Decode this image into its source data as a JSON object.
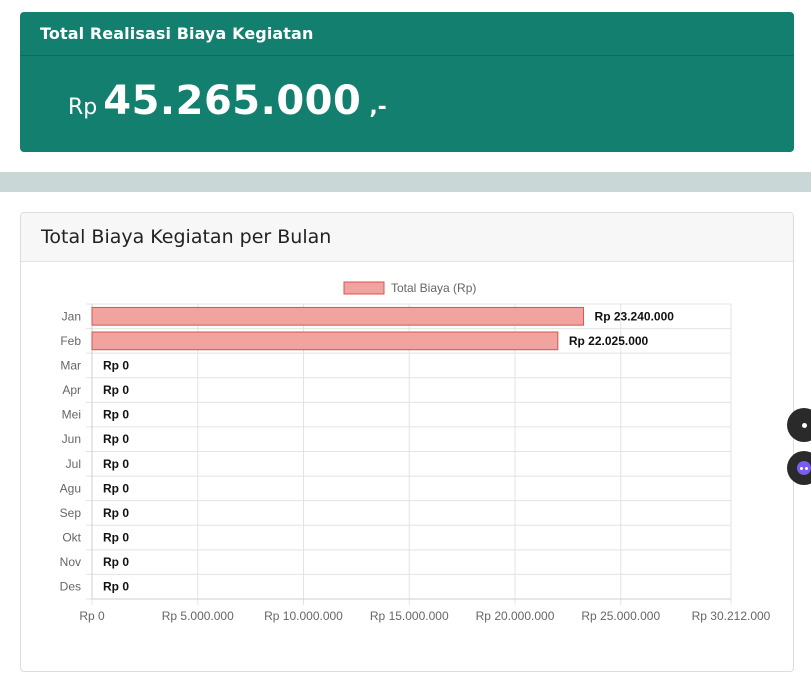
{
  "summary": {
    "title": "Total Realisasi Biaya Kegiatan",
    "currency": "Rp",
    "amount": "45.265.000",
    "suffix": ",-"
  },
  "chart_card": {
    "title": "Total Biaya Kegiatan per Bulan"
  },
  "colors": {
    "summary_bg": "#137f6e",
    "bar_fill": "#f1a3a0",
    "bar_border": "#d9534f",
    "band": "#c9d8d6"
  },
  "chart_data": {
    "type": "bar",
    "orientation": "horizontal",
    "legend": "Total Biaya (Rp)",
    "legend_position": "top",
    "categories": [
      "Jan",
      "Feb",
      "Mar",
      "Apr",
      "Mei",
      "Jun",
      "Jul",
      "Agu",
      "Sep",
      "Okt",
      "Nov",
      "Des"
    ],
    "values": [
      23240000,
      22025000,
      0,
      0,
      0,
      0,
      0,
      0,
      0,
      0,
      0,
      0
    ],
    "value_labels": [
      "Rp 23.240.000",
      "Rp 22.025.000",
      "Rp 0",
      "Rp 0",
      "Rp 0",
      "Rp 0",
      "Rp 0",
      "Rp 0",
      "Rp 0",
      "Rp 0",
      "Rp 0",
      "Rp 0"
    ],
    "x_ticks": [
      0,
      5000000,
      10000000,
      15000000,
      20000000,
      25000000,
      30212000
    ],
    "x_tick_labels": [
      "Rp 0",
      "Rp 5.000.000",
      "Rp 10.000.000",
      "Rp 15.000.000",
      "Rp 20.000.000",
      "Rp 25.000.000",
      "Rp 30.212.000"
    ],
    "xlim": [
      0,
      30212000
    ],
    "grid": true
  }
}
